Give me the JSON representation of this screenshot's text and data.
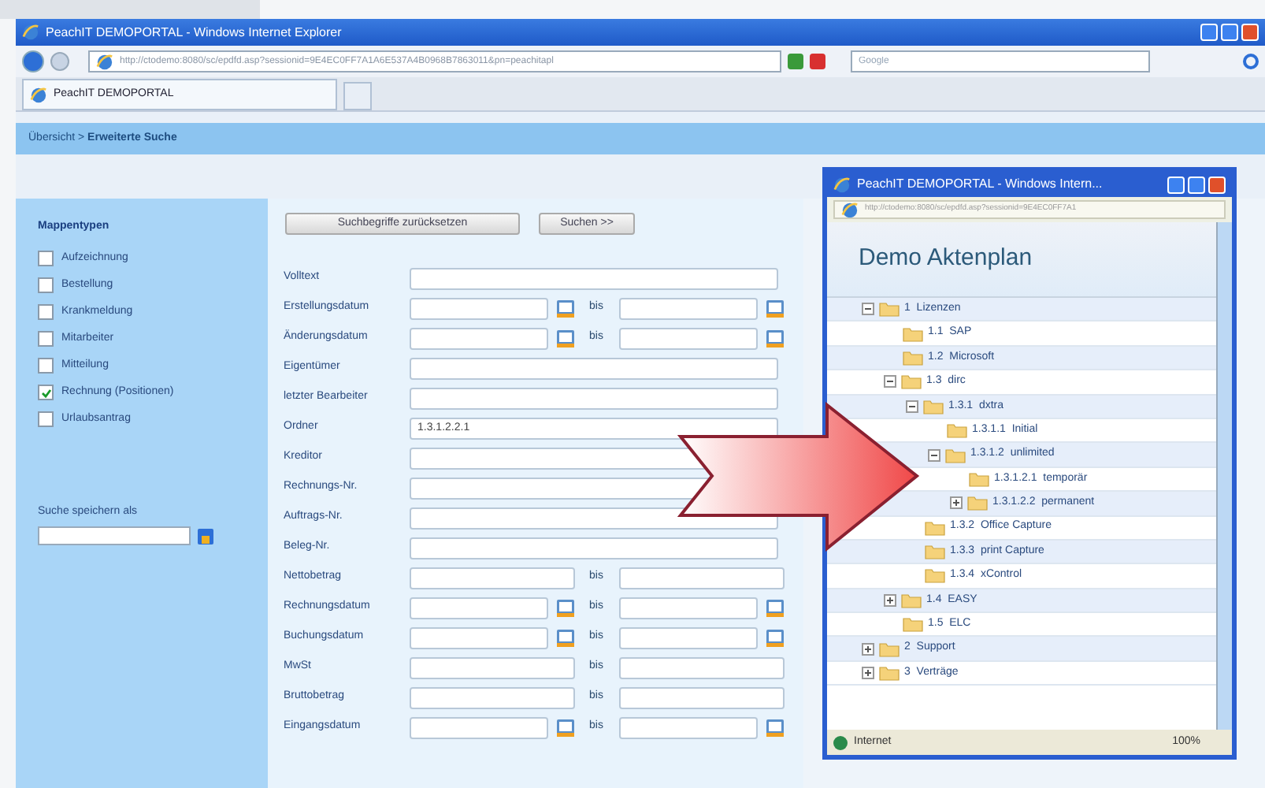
{
  "browser": {
    "title": "PeachIT DEMOPORTAL - Windows Internet Explorer",
    "address": "http://ctodemo:8080/sc/epdfd.asp?sessionid=9E4EC0FF7A1A6E537A4B0968B7863011&pn=peachitapl",
    "search_placeholder": "Google",
    "tab": "PeachIT DEMOPORTAL"
  },
  "breadcrumb": "Übersicht > **Erweiterte Suche**",
  "sidebar": {
    "heading": "Mappentypen",
    "types": [
      {
        "label": "Aufzeichnung",
        "checked": false
      },
      {
        "label": "Bestellung",
        "checked": false
      },
      {
        "label": "Krankmeldung",
        "checked": false
      },
      {
        "label": "Mitarbeiter",
        "checked": false
      },
      {
        "label": "Mitteilung",
        "checked": false
      },
      {
        "label": "Rechnung (Positionen)",
        "checked": true
      },
      {
        "label": "Urlaubsantrag",
        "checked": false
      }
    ],
    "save_label": "Suche speichern als"
  },
  "buttons": [
    "Suchbegriffe zurücksetzen",
    "Suchen >>"
  ],
  "fields": [
    {
      "label": "Volltext",
      "kind": "text"
    },
    {
      "label": "Erstellungsdatum",
      "kind": "date_range",
      "to_label": "bis"
    },
    {
      "label": "Änderungsdatum",
      "kind": "date_range",
      "to_label": "bis"
    },
    {
      "label": "Eigentümer",
      "kind": "text"
    },
    {
      "label": "letzter Bearbeiter",
      "kind": "text"
    },
    {
      "label": "Ordner",
      "kind": "text",
      "value": "1.3.1.2.2.1"
    },
    {
      "label": "Kreditor",
      "kind": "text"
    },
    {
      "label": "Rechnungs-Nr.",
      "kind": "text"
    },
    {
      "label": "Auftrags-Nr.",
      "kind": "text"
    },
    {
      "label": "Beleg-Nr.",
      "kind": "text"
    },
    {
      "label": "Nettobetrag",
      "kind": "range",
      "to_label": "bis"
    },
    {
      "label": "Rechnungsdatum",
      "kind": "date_range",
      "to_label": "bis"
    },
    {
      "label": "Buchungsdatum",
      "kind": "date_range",
      "to_label": "bis"
    },
    {
      "label": "MwSt",
      "kind": "range",
      "to_label": "bis"
    },
    {
      "label": "Bruttobetrag",
      "kind": "range",
      "to_label": "bis"
    },
    {
      "label": "Eingangsdatum",
      "kind": "date_range",
      "to_label": "bis"
    }
  ],
  "popup": {
    "title": "PeachIT DEMOPORTAL - Windows Intern...",
    "address": "http://ctodemo:8080/sc/epdfd.asp?sessionid=9E4EC0FF7A1",
    "heading": "Demo Aktenplan",
    "tree": [
      {
        "number": "1",
        "label": "Lizenzen",
        "expanded": true,
        "children": [
          {
            "number": "1.1",
            "label": "SAP"
          },
          {
            "number": "1.2",
            "label": "Microsoft"
          },
          {
            "number": "1.3",
            "label": "dirc",
            "expanded": true,
            "children": [
              {
                "number": "1.3.1",
                "label": "dxtra",
                "expanded": true,
                "children": [
                  {
                    "number": "1.3.1.1",
                    "label": "Initial"
                  },
                  {
                    "number": "1.3.1.2",
                    "label": "unlimited",
                    "expanded": true,
                    "children": [
                      {
                        "number": "1.3.1.2.1",
                        "label": "temporär"
                      },
                      {
                        "number": "1.3.1.2.2",
                        "label": "permanent",
                        "expanded": false
                      }
                    ]
                  }
                ]
              },
              {
                "number": "1.3.2",
                "label": "Office Capture"
              },
              {
                "number": "1.3.3",
                "label": "print Capture"
              },
              {
                "number": "1.3.4",
                "label": "xControl"
              }
            ]
          },
          {
            "number": "1.4",
            "label": "EASY",
            "expanded": false
          },
          {
            "number": "1.5",
            "label": "ELC"
          }
        ]
      },
      {
        "number": "2",
        "label": "Support",
        "expanded": false
      },
      {
        "number": "3",
        "label": "Verträge",
        "expanded": false
      }
    ],
    "status": "Internet",
    "zoom": "100%"
  }
}
